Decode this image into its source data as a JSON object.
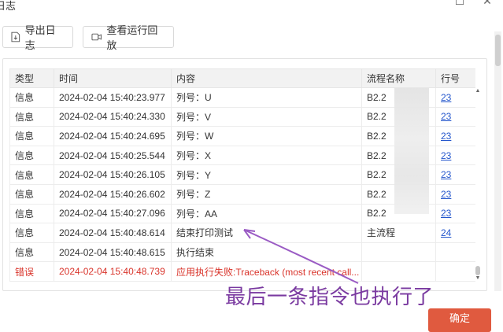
{
  "window": {
    "title": "日志",
    "minimize": "☐",
    "close": "✕"
  },
  "toolbar": {
    "export_label": "导出日志",
    "replay_label": "查看运行回放"
  },
  "table": {
    "headers": [
      "类型",
      "时间",
      "内容",
      "流程名称",
      "行号"
    ],
    "rows": [
      {
        "type": "信息",
        "time": "2024-02-04 15:40:23.977",
        "content": "列号：U",
        "flow": "B2.2",
        "line": "23",
        "error": false
      },
      {
        "type": "信息",
        "time": "2024-02-04 15:40:24.330",
        "content": "列号：V",
        "flow": "B2.2",
        "line": "23",
        "error": false
      },
      {
        "type": "信息",
        "time": "2024-02-04 15:40:24.695",
        "content": "列号：W",
        "flow": "B2.2",
        "line": "23",
        "error": false
      },
      {
        "type": "信息",
        "time": "2024-02-04 15:40:25.544",
        "content": "列号：X",
        "flow": "B2.2",
        "line": "23",
        "error": false
      },
      {
        "type": "信息",
        "time": "2024-02-04 15:40:26.105",
        "content": "列号：Y",
        "flow": "B2.2",
        "line": "23",
        "error": false
      },
      {
        "type": "信息",
        "time": "2024-02-04 15:40:26.602",
        "content": "列号：Z",
        "flow": "B2.2",
        "line": "23",
        "error": false
      },
      {
        "type": "信息",
        "time": "2024-02-04 15:40:27.096",
        "content": "列号：AA",
        "flow": "B2.2",
        "line": "23",
        "error": false
      },
      {
        "type": "信息",
        "time": "2024-02-04 15:40:48.614",
        "content": "结束打印测试",
        "flow": "主流程",
        "line": "24",
        "error": false
      },
      {
        "type": "信息",
        "time": "2024-02-04 15:40:48.615",
        "content": "执行结束",
        "flow": "",
        "line": "",
        "error": false
      },
      {
        "type": "错误",
        "time": "2024-02-04 15:40:48.739",
        "content": "应用执行失败:Traceback (most recent call...",
        "flow": "",
        "line": "",
        "error": true
      }
    ]
  },
  "annotation": {
    "text": "最后一条指令也执行了",
    "color": "#7a3aa0"
  },
  "footer": {
    "confirm_label": "确定"
  },
  "colors": {
    "error": "#d9342b",
    "link": "#2255cc",
    "confirm_bg": "#e05a3f"
  }
}
